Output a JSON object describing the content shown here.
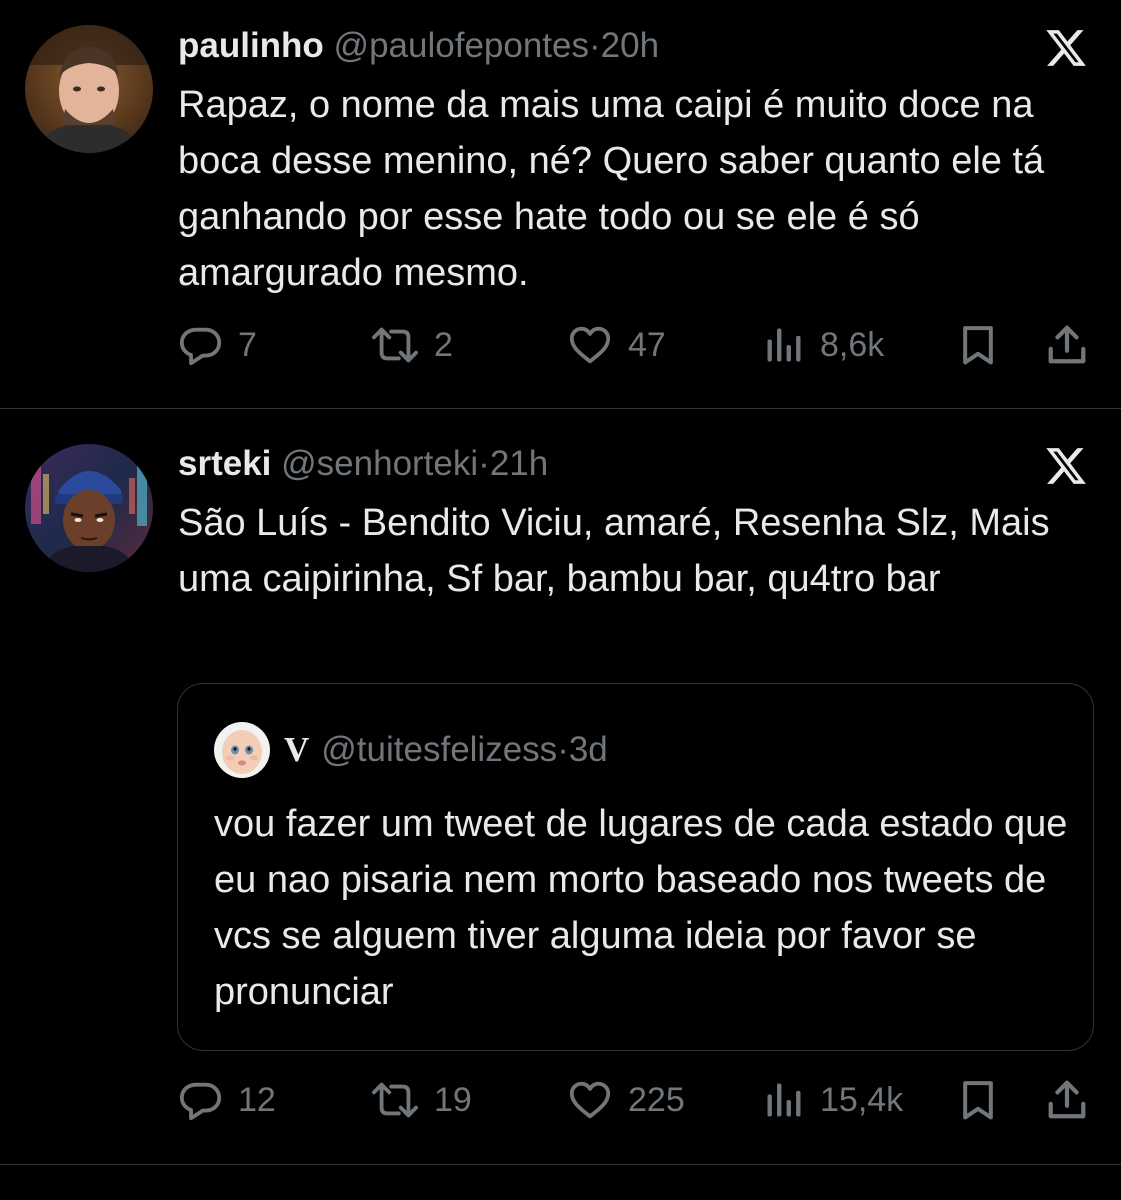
{
  "tweets": [
    {
      "name": "paulinho",
      "handle": "@paulofepontes",
      "dot": "·",
      "time": "20h",
      "text": "Rapaz, o nome da mais uma caipi é muito doce na boca desse menino, né? Quero saber quanto ele tá ganhando por esse hate todo ou se ele é só amargurado mesmo.",
      "replies": "7",
      "reposts": "2",
      "likes": "47",
      "views": "8,6k"
    },
    {
      "name": "srteki",
      "handle": "@senhorteki",
      "dot": "·",
      "time": "21h",
      "text": "São Luís - Bendito Viciu, amaré, Resenha Slz, Mais uma caipirinha, Sf bar, bambu bar, qu4tro bar",
      "quote": {
        "name": "V",
        "handle": "@tuitesfelizess",
        "dot": "·",
        "time": "3d",
        "text": "vou fazer um tweet de lugares de cada estado que eu nao pisaria nem morto baseado nos tweets de vcs se alguem tiver alguma ideia por favor se pronunciar"
      },
      "replies": "12",
      "reposts": "19",
      "likes": "225",
      "views": "15,4k"
    }
  ],
  "icons": {
    "brand": "x-logo-icon",
    "reply": "reply-icon",
    "repost": "repost-icon",
    "like": "heart-icon",
    "views": "views-icon",
    "bookmark": "bookmark-icon",
    "share": "share-icon"
  },
  "colors": {
    "background": "#000000",
    "text": "#e7e9ea",
    "secondary": "#71767b",
    "border": "#2f3336"
  }
}
